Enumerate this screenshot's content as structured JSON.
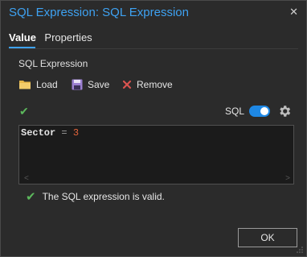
{
  "dialog": {
    "title": "SQL Expression: SQL Expression",
    "close_icon": "close-icon"
  },
  "tabs": [
    {
      "label": "Value",
      "active": true
    },
    {
      "label": "Properties",
      "active": false
    }
  ],
  "section": {
    "label": "SQL Expression"
  },
  "toolbar": {
    "load_label": "Load",
    "save_label": "Save",
    "remove_label": "Remove",
    "load_icon": "folder-icon",
    "save_icon": "floppy-disk-icon",
    "remove_icon": "red-x-icon"
  },
  "sql_toggle": {
    "label": "SQL",
    "on": true
  },
  "editor": {
    "field": "Sector",
    "operator": "=",
    "value": "3"
  },
  "validation": {
    "message": "The SQL expression is valid."
  },
  "buttons": {
    "ok_label": "OK"
  },
  "colors": {
    "accent": "#3ea2f2",
    "valid_green": "#5cb85c",
    "remove_red": "#d9534f",
    "literal_orange": "#e8663b",
    "folder_yellow": "#e8b84a",
    "save_purple": "#9b7fd1"
  }
}
